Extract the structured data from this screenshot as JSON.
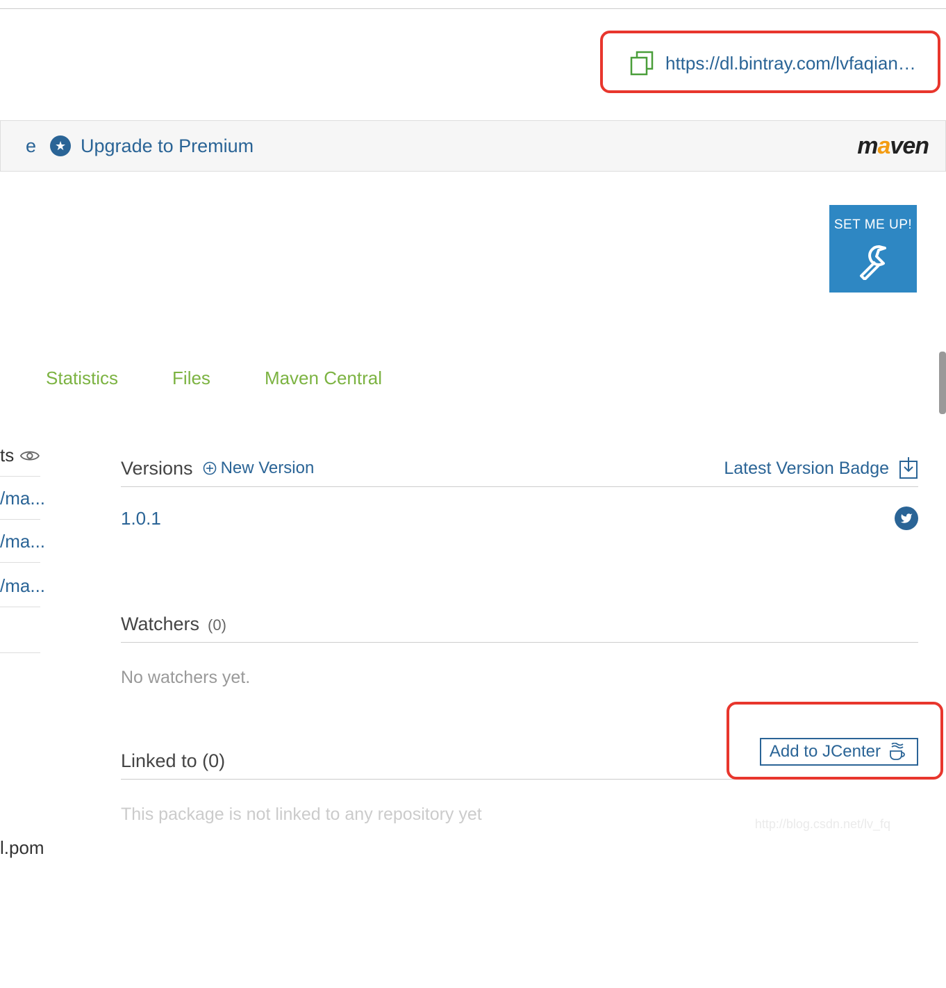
{
  "url_box": "https://dl.bintray.com/lvfaqiang/mav…",
  "premium": {
    "partial": "e",
    "upgrade": "Upgrade to Premium"
  },
  "maven_logo": {
    "m": "m",
    "a": "a",
    "rest": "ven"
  },
  "setmeup": "SET ME UP!",
  "tabs": {
    "statistics": "Statistics",
    "files": "Files",
    "maven_central": "Maven Central"
  },
  "side": {
    "ts": "ts",
    "ma1": "/ma...",
    "ma2": "/ma...",
    "ma3": "/ma...",
    "pom": "l.pom"
  },
  "versions": {
    "title": "Versions",
    "new": "New Version",
    "badge": "Latest Version Badge",
    "v101": "1.0.1"
  },
  "watchers": {
    "title": "Watchers",
    "count": "(0)",
    "empty": "No watchers yet."
  },
  "linked": {
    "title": "Linked to (0)",
    "jcenter": "Add to JCenter",
    "not_linked": "This package is not linked to any repository yet"
  },
  "watermark": "http://blog.csdn.net/lv_fq"
}
